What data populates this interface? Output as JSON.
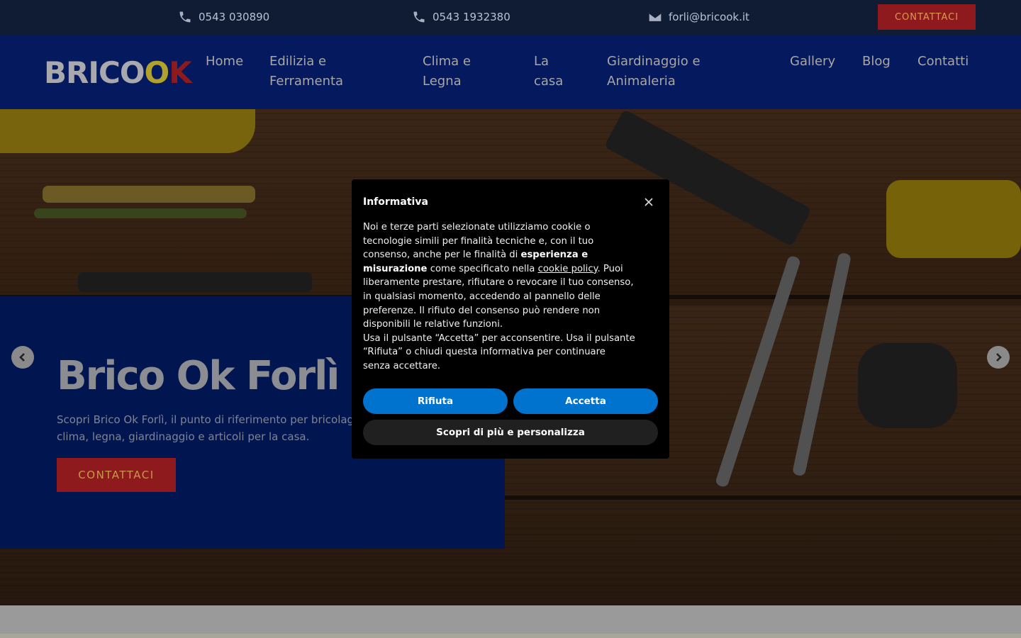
{
  "topbar": {
    "phone1": "0543 030890",
    "phone2": "0543 1932380",
    "email": "forli@bricook.it",
    "cta_label": "CONTATTACI",
    "icons": [
      "phone-icon",
      "phone-icon",
      "mail-icon"
    ]
  },
  "header": {
    "logo": {
      "part1": "BRIC",
      "part2": "O",
      "part3": "O",
      "part4": "K"
    },
    "nav": [
      {
        "label": "Home"
      },
      {
        "label": "Edilizia e Ferramenta"
      },
      {
        "label": "Clima e Legna"
      },
      {
        "label": "La casa"
      },
      {
        "label": "Giardinaggio e Animaleria"
      },
      {
        "label": "Gallery"
      },
      {
        "label": "Blog"
      },
      {
        "label": "Contatti"
      }
    ]
  },
  "hero": {
    "title": "Brico Ok Forlì",
    "text": "Scopri Brico Ok Forlì, il punto di riferimento per bricolage, edilizia, ferramenta, clima, legna, giardinaggio e articoli per la casa.",
    "cta_label": "CONTATTACI",
    "prev_icon": "chevron-left-icon",
    "next_icon": "chevron-right-icon"
  },
  "cookie_banner": {
    "title": "Informativa",
    "body_part1": "Noi e terze parti selezionate utilizziamo cookie o tecnologie simili per finalità tecniche e, con il tuo consenso, anche per le finalità di ",
    "body_bold": "esperienza e misurazione",
    "body_part2": " come specificato nella ",
    "body_link": "cookie policy",
    "body_part3": ". Puoi liberamente prestare, rifiutare o revocare il tuo consenso, in qualsiasi momento, accedendo al pannello delle preferenze. Il rifiuto del consenso può rendere non disponibili le relative funzioni.",
    "body_part4": "Usa il pulsante “Accetta” per acconsentire. Usa il pulsante “Rifiuta” o chiudi questa informativa per continuare senza accettare.",
    "reject_label": "Rifiuta",
    "accept_label": "Accetta",
    "more_label": "Scopri di più e personalizza"
  },
  "colors": {
    "topbar_bg": "#0f1c33",
    "header_bg": "#04195e",
    "brand_red": "#8e1a1e",
    "button_blue": "#0073ce"
  }
}
